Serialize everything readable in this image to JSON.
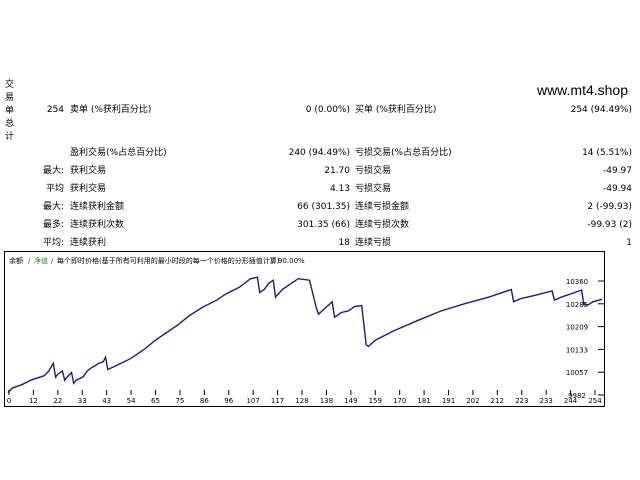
{
  "header": {
    "vertical_title": [
      "交",
      "易",
      "单",
      "总",
      "计"
    ],
    "site": "www.mt4.shop"
  },
  "row1": {
    "count": "254",
    "sell_label": "卖单 (%获利百分比)",
    "sell_value": "0 (0.00%)",
    "buy_label": "买单 (%获利百分比)",
    "buy_value": "254 (94.49%)"
  },
  "rows": [
    {
      "prefix": "",
      "left_label": "盈利交易(%占总百分比)",
      "left_value": "240 (94.49%)",
      "right_label": "亏损交易(%占总百分比)",
      "right_value": "14 (5.51%)"
    },
    {
      "prefix": "最大:",
      "left_label": "获利交易",
      "left_value": "21.70",
      "right_label": "亏损交易",
      "right_value": "-49.97"
    },
    {
      "prefix": "平均",
      "left_label": "获利交易",
      "left_value": "4.13",
      "right_label": "亏损交易",
      "right_value": "-49.94"
    },
    {
      "prefix": "最大:",
      "left_label": "连续获利金额",
      "left_value": "66 (301.35)",
      "right_label": "连续亏损金额",
      "right_value": "2 (-99.93)"
    },
    {
      "prefix": "最多:",
      "left_label": "连续获利次数",
      "left_value": "301.35 (66)",
      "right_label": "连续亏损次数",
      "right_value": "-99.93 (2)"
    },
    {
      "prefix": "平均:",
      "left_label": "连续获利",
      "left_value": "18",
      "right_label": "连续亏损",
      "right_value": "1"
    }
  ],
  "chart_legend": {
    "balance": "余额",
    "equity": "净值",
    "model_text": "每个即时价格(基于所有可利用的最小时段的每一个价格的分形插值计算)",
    "quality": "90.00%"
  },
  "colors": {
    "line": "#1a1a8c",
    "axis": "#000000",
    "grid": "#b0b0b0",
    "legend_balance": "#1a1a8c",
    "legend_equity": "#2a8a2a"
  },
  "chart_data": {
    "type": "line",
    "x_ticks": [
      "0",
      "12",
      "22",
      "33",
      "43",
      "54",
      "65",
      "75",
      "86",
      "96",
      "107",
      "117",
      "128",
      "138",
      "149",
      "159",
      "170",
      "181",
      "191",
      "202",
      "212",
      "223",
      "233",
      "244",
      "254"
    ],
    "y_ticks": [
      "10360",
      "10285",
      "10209",
      "10133",
      "10057",
      "9982"
    ],
    "ylim": [
      9982,
      10398
    ],
    "xlim": [
      0,
      262
    ],
    "grid": true,
    "series": [
      {
        "values": [
          [
            0,
            9990
          ],
          [
            2,
            10005
          ],
          [
            6,
            10015
          ],
          [
            10,
            10030
          ],
          [
            14,
            10040
          ],
          [
            16,
            10045
          ],
          [
            18,
            10060
          ],
          [
            20,
            10085
          ],
          [
            21,
            10040
          ],
          [
            22,
            10050
          ],
          [
            24,
            10060
          ],
          [
            25,
            10030
          ],
          [
            26,
            10040
          ],
          [
            28,
            10055
          ],
          [
            29,
            10020
          ],
          [
            30,
            10030
          ],
          [
            33,
            10040
          ],
          [
            35,
            10060
          ],
          [
            37,
            10072
          ],
          [
            38,
            10075
          ],
          [
            40,
            10085
          ],
          [
            42,
            10090
          ],
          [
            43,
            10105
          ],
          [
            44,
            10065
          ],
          [
            47,
            10075
          ],
          [
            54,
            10100
          ],
          [
            60,
            10130
          ],
          [
            65,
            10160
          ],
          [
            70,
            10185
          ],
          [
            75,
            10210
          ],
          [
            80,
            10240
          ],
          [
            86,
            10268
          ],
          [
            92,
            10290
          ],
          [
            96,
            10310
          ],
          [
            102,
            10332
          ],
          [
            107,
            10360
          ],
          [
            110,
            10365
          ],
          [
            111,
            10315
          ],
          [
            113,
            10325
          ],
          [
            115,
            10345
          ],
          [
            117,
            10355
          ],
          [
            118,
            10300
          ],
          [
            121,
            10325
          ],
          [
            125,
            10345
          ],
          [
            128,
            10360
          ],
          [
            133,
            10355
          ],
          [
            134,
            10325
          ],
          [
            136,
            10265
          ],
          [
            137,
            10245
          ],
          [
            140,
            10265
          ],
          [
            143,
            10285
          ],
          [
            144,
            10235
          ],
          [
            147,
            10250
          ],
          [
            150,
            10255
          ],
          [
            153,
            10270
          ],
          [
            156,
            10273
          ],
          [
            158,
            10145
          ],
          [
            159,
            10140
          ],
          [
            162,
            10160
          ],
          [
            170,
            10190
          ],
          [
            181,
            10225
          ],
          [
            191,
            10255
          ],
          [
            202,
            10280
          ],
          [
            212,
            10300
          ],
          [
            222,
            10325
          ],
          [
            223,
            10285
          ],
          [
            226,
            10295
          ],
          [
            232,
            10305
          ],
          [
            240,
            10320
          ],
          [
            241,
            10290
          ],
          [
            244,
            10300
          ],
          [
            250,
            10315
          ],
          [
            253,
            10323
          ],
          [
            254,
            10275
          ],
          [
            256,
            10275
          ],
          [
            258,
            10285
          ],
          [
            262,
            10293
          ]
        ]
      }
    ]
  }
}
